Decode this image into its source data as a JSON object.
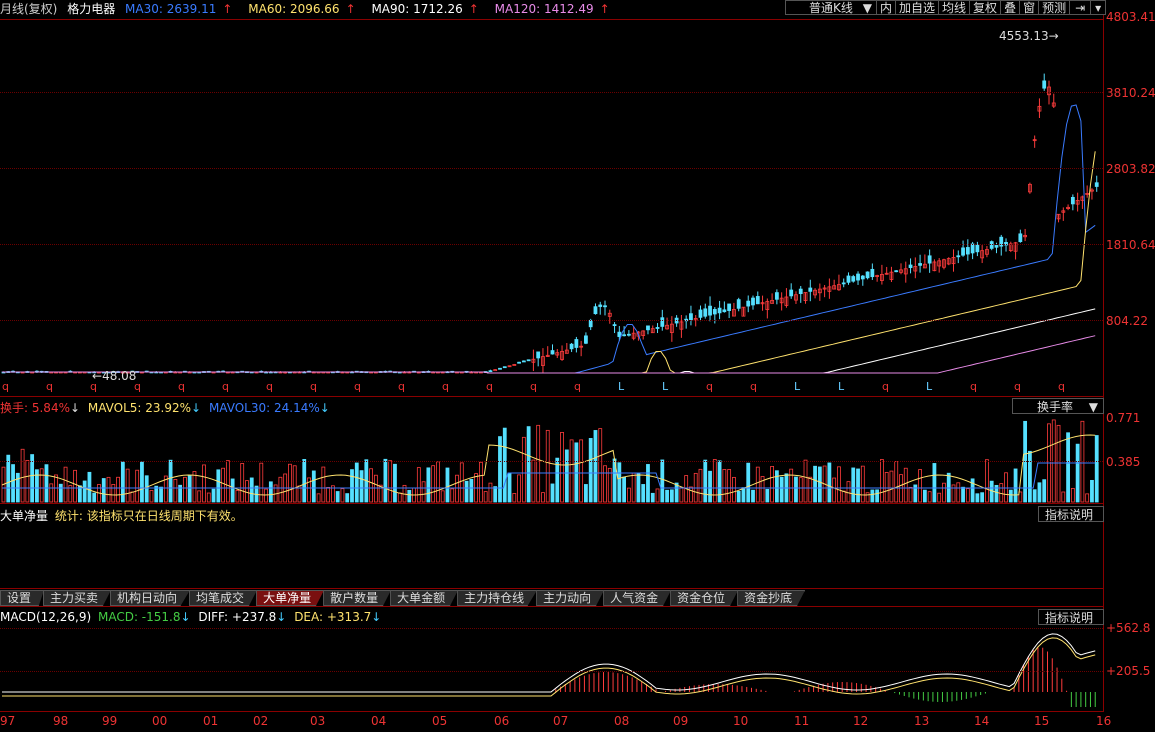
{
  "header": {
    "period": "月线(复权)",
    "stock": "格力电器",
    "ma": [
      {
        "label": "MA30: 2639.11",
        "color": "#3a7bff"
      },
      {
        "label": "MA60: 2096.66",
        "color": "#ffe26e"
      },
      {
        "label": "MA90: 1712.26",
        "color": "#ffffff"
      },
      {
        "label": "MA120: 1412.49",
        "color": "#e88be8"
      }
    ]
  },
  "toolbar": {
    "chart_type": "普通K线",
    "buttons": [
      "内",
      "加自选",
      "均线",
      "复权",
      "叠",
      "窗",
      "预测"
    ]
  },
  "main_chart": {
    "y_ticks": [
      "4803.41",
      "3810.24",
      "2803.82",
      "1810.64",
      "804.22"
    ],
    "high_label": "4553.13",
    "low_label": "48.08"
  },
  "turnover": {
    "title": "换手: 5.84%",
    "mavol5": "MAVOL5: 23.92%",
    "mavol30": "MAVOL30: 24.14%",
    "selector": "换手率",
    "y_ticks": [
      "0.771",
      "0.385"
    ]
  },
  "big_order": {
    "title": "大单净量",
    "note": "统计: 该指标只在日线周期下有效。",
    "help": "指标说明"
  },
  "tabs": [
    "设置",
    "主力买卖",
    "机构日动向",
    "均笔成交",
    "大单净量",
    "散户数量",
    "大单金额",
    "主力持仓线",
    "主力动向",
    "人气资金",
    "资金仓位",
    "资金抄底"
  ],
  "active_tab": "大单净量",
  "macd": {
    "title": "MACD(12,26,9)",
    "macd": "MACD: -151.8",
    "diff": "DIFF: +237.8",
    "dea": "DEA: +313.7",
    "help": "指标说明",
    "y_ticks": [
      "+562.8",
      "+205.5"
    ]
  },
  "x_axis": [
    "97",
    "98",
    "99",
    "00",
    "01",
    "02",
    "03",
    "04",
    "05",
    "06",
    "07",
    "08",
    "09",
    "10",
    "11",
    "12",
    "13",
    "14",
    "15",
    "16"
  ],
  "event_markers": [
    "q",
    "q",
    "q",
    "q",
    "q",
    "q",
    "q",
    "q",
    "q",
    "q",
    "q",
    "q",
    "q",
    "q",
    "L",
    "L",
    "q",
    "q",
    "L",
    "L",
    "q",
    "L",
    "q",
    "q",
    "q"
  ]
}
